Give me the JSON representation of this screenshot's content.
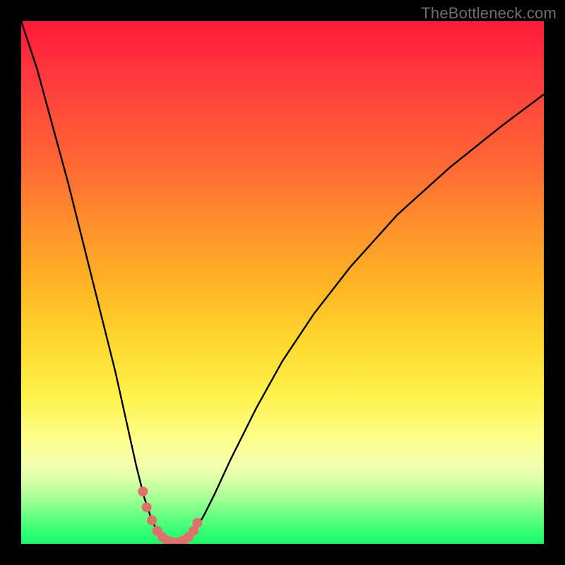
{
  "watermark": "TheBottleneck.com",
  "chart_data": {
    "type": "line",
    "title": "",
    "xlabel": "",
    "ylabel": "",
    "xlim": [
      0,
      100
    ],
    "ylim": [
      0,
      100
    ],
    "x": [
      0,
      3,
      6,
      9,
      12,
      15,
      18,
      20,
      22,
      23.5,
      25,
      26,
      27,
      28,
      29,
      30,
      31,
      32,
      33.5,
      35,
      37,
      40,
      45,
      50,
      56,
      63,
      72,
      82,
      92,
      100
    ],
    "y": [
      100,
      91,
      80,
      69,
      57,
      45,
      33,
      24,
      15,
      9,
      4.5,
      2.5,
      1.3,
      0.6,
      0.3,
      0.3,
      0.6,
      1.3,
      3.0,
      5.5,
      9.5,
      16,
      26,
      35,
      44,
      53,
      63,
      72,
      80,
      86
    ],
    "markers": {
      "x": [
        23.3,
        24.0,
        25.0,
        26.0,
        27.0,
        28.0,
        29.0,
        30.0,
        31.0,
        32.0,
        33.0,
        33.7
      ],
      "y": [
        10.0,
        7.0,
        4.5,
        2.5,
        1.3,
        0.6,
        0.3,
        0.3,
        0.6,
        1.3,
        2.5,
        4.0
      ],
      "color": "#e0716a",
      "radius": 7
    },
    "curve_color": "#000000",
    "gradient": [
      "#ff1a3a",
      "#ffda2f",
      "#17f96a"
    ]
  }
}
